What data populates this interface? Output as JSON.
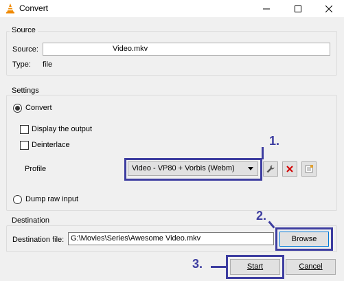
{
  "window": {
    "title": "Convert",
    "icon": "vlc-cone-icon"
  },
  "source": {
    "group_label": "Source",
    "source_label": "Source:",
    "source_value": "Video.mkv",
    "type_label": "Type:",
    "type_value": "file"
  },
  "settings": {
    "group_label": "Settings",
    "convert_label": "Convert",
    "convert_selected": true,
    "display_output_label": "Display the output",
    "display_output_checked": false,
    "deinterlace_label": "Deinterlace",
    "deinterlace_checked": false,
    "profile_label": "Profile",
    "profile_selected": "Video - VP80 + Vorbis (Webm)",
    "dump_raw_label": "Dump raw input",
    "dump_raw_selected": false
  },
  "destination": {
    "group_label": "Destination",
    "file_label": "Destination file:",
    "file_value": "G:\\Movies\\Series\\Awesome Video.mkv",
    "browse_label": "Browse"
  },
  "footer": {
    "start_label": "Start",
    "cancel_label": "Cancel"
  },
  "annotations": {
    "step1": "1.",
    "step2": "2.",
    "step3": "3.",
    "color": "#3d3da0"
  }
}
